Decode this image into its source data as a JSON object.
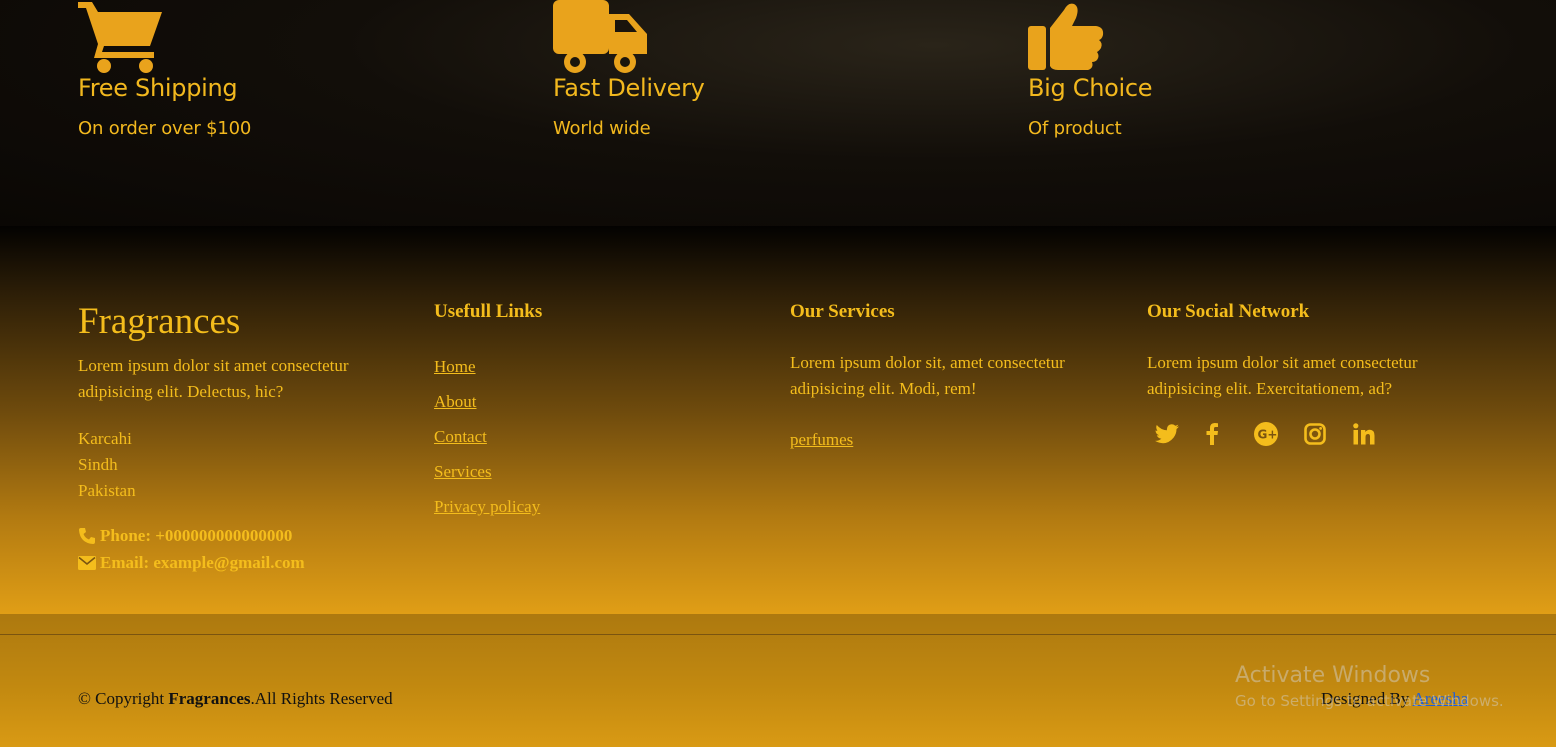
{
  "colors": {
    "accent": "#f4bd1c",
    "icon": "#e9a31c",
    "link": "#1f5fd6"
  },
  "features": [
    {
      "icon": "shopping-cart-icon",
      "title": "Free Shipping",
      "subtitle": "On order over $100"
    },
    {
      "icon": "truck-icon",
      "title": "Fast Delivery",
      "subtitle": "World wide"
    },
    {
      "icon": "thumbs-up-icon",
      "title": "Big Choice",
      "subtitle": "Of product"
    }
  ],
  "footer": {
    "brand": {
      "name": "Fragrances",
      "description": "Lorem ipsum dolor sit amet consectetur adipisicing elit. Delectus, hic?",
      "address": [
        "Karcahi",
        "Sindh",
        "Pakistan"
      ],
      "phone": "Phone: +000000000000000",
      "email": "Email: example@gmail.com"
    },
    "links": {
      "heading": "Usefull Links",
      "items": [
        "Home",
        "About",
        "Contact",
        "Services",
        "Privacy policay"
      ]
    },
    "services": {
      "heading": "Our Services",
      "description": "Lorem ipsum dolor sit, amet consectetur adipisicing elit. Modi, rem!",
      "link": "perfumes"
    },
    "social": {
      "heading": "Our Social Network",
      "description": "Lorem ipsum dolor sit amet consectetur adipisicing elit. Exercitationem, ad?",
      "icons": [
        "twitter-icon",
        "facebook-icon",
        "google-plus-icon",
        "instagram-icon",
        "linkedin-icon"
      ]
    }
  },
  "bottom": {
    "copyright_prefix": "© Copyright ",
    "copyright_brand": "Fragrances",
    "copyright_suffix": ".All Rights Reserved",
    "designed_by": "Designed By ",
    "designer": "Areesha"
  },
  "overlay": {
    "title": "Activate Windows",
    "subtitle": "Go to Settings to activate Windows."
  }
}
